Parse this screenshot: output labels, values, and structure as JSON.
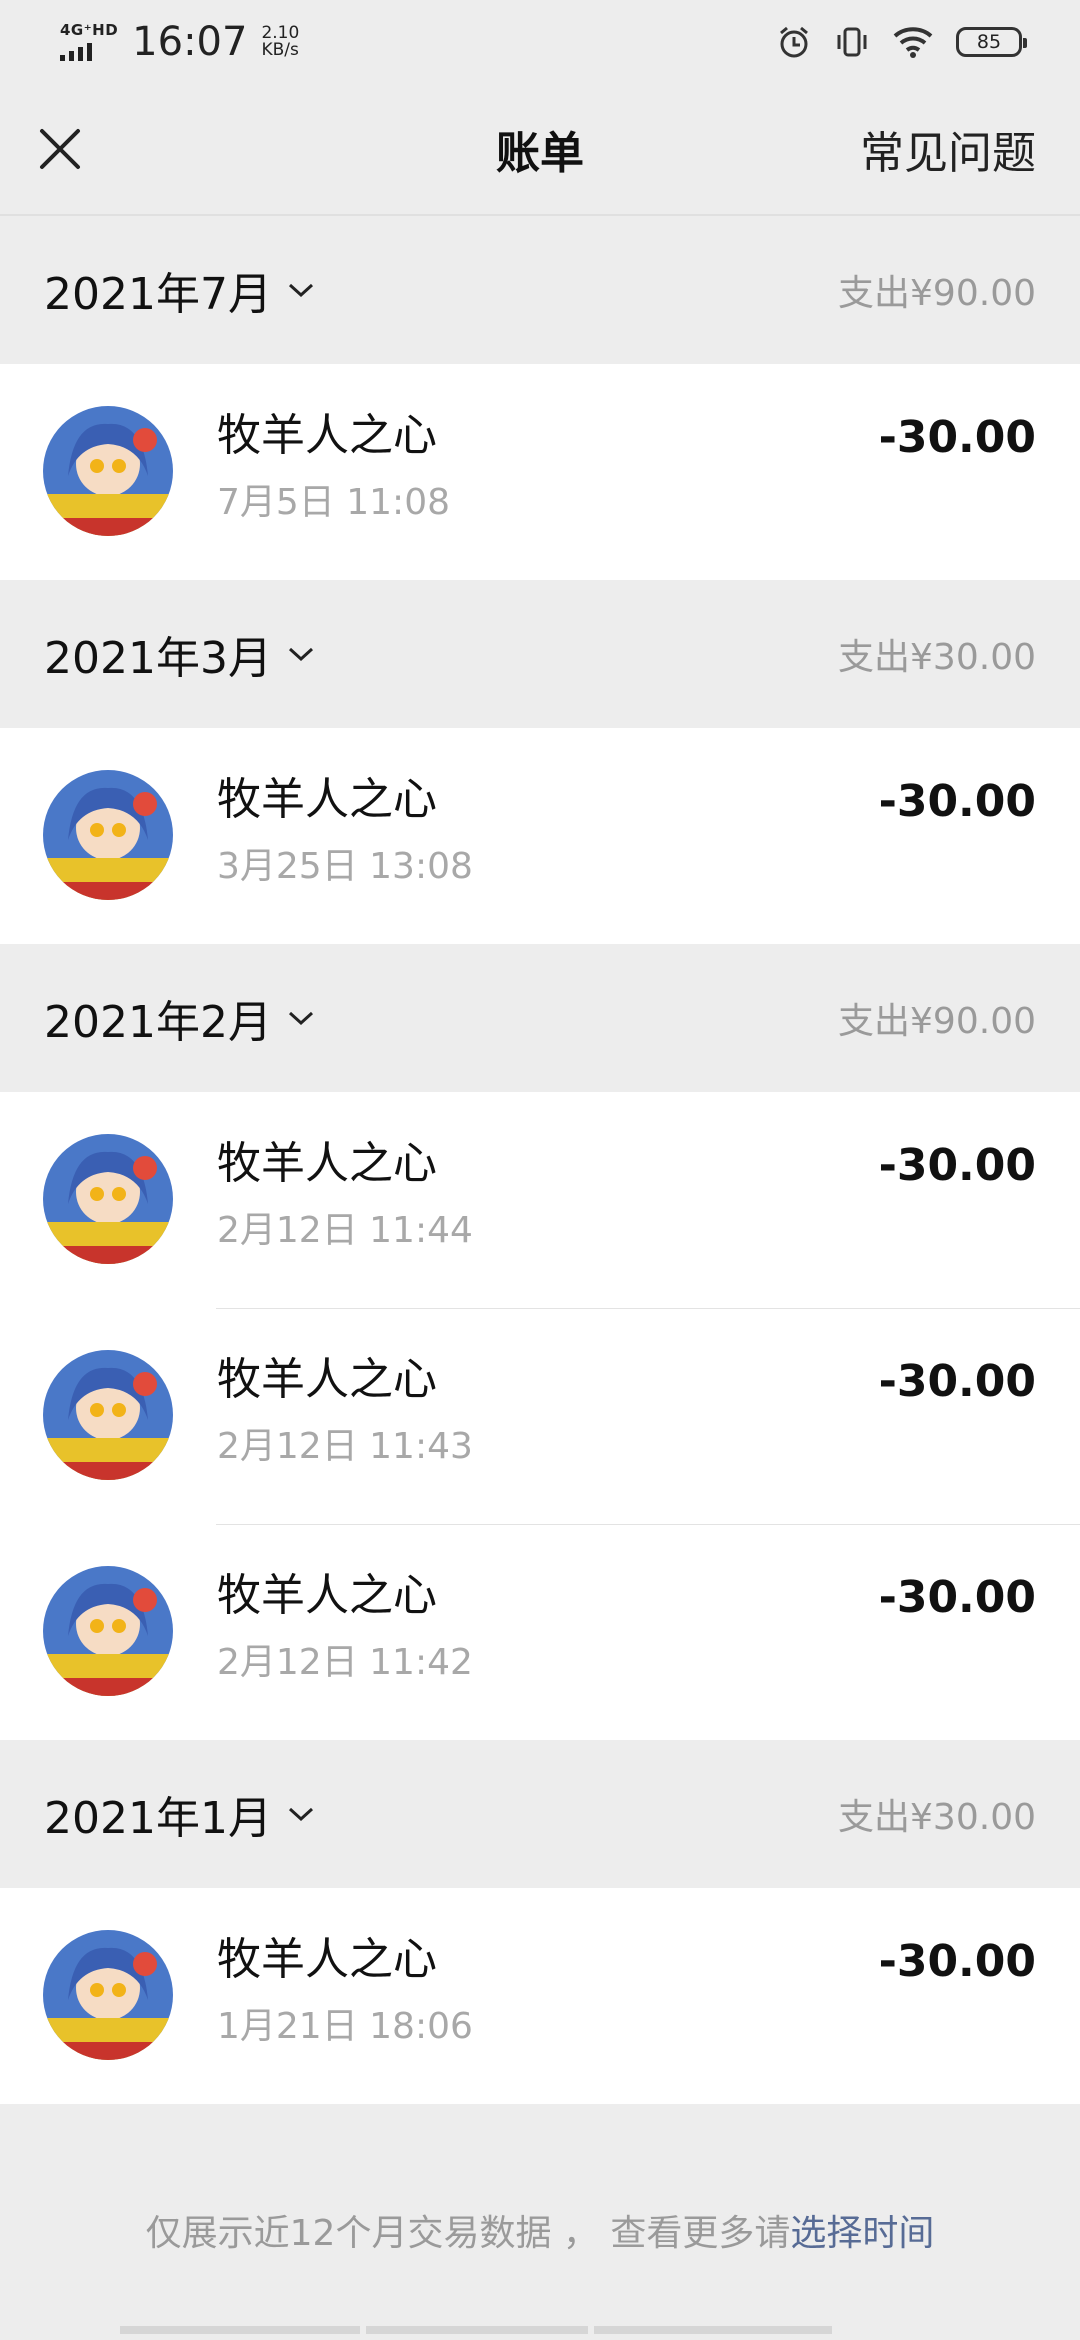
{
  "status_bar": {
    "network": "4G⁺HD",
    "time": "16:07",
    "speed_value": "2.10",
    "speed_unit": "KB/s",
    "battery": "85",
    "icons": [
      "alarm-icon",
      "vibrate-icon",
      "wifi-icon",
      "battery-icon"
    ]
  },
  "nav": {
    "close_icon": "close-icon",
    "title": "账单",
    "faq_label": "常见问题"
  },
  "groups": [
    {
      "month": "2021年7月",
      "total": "支出¥90.00",
      "records": [
        {
          "name": "牧羊人之心",
          "time": "7月5日 11:08",
          "amount": "-30.00"
        }
      ]
    },
    {
      "month": "2021年3月",
      "total": "支出¥30.00",
      "records": [
        {
          "name": "牧羊人之心",
          "time": "3月25日 13:08",
          "amount": "-30.00"
        }
      ]
    },
    {
      "month": "2021年2月",
      "total": "支出¥90.00",
      "records": [
        {
          "name": "牧羊人之心",
          "time": "2月12日 11:44",
          "amount": "-30.00"
        },
        {
          "name": "牧羊人之心",
          "time": "2月12日 11:43",
          "amount": "-30.00"
        },
        {
          "name": "牧羊人之心",
          "time": "2月12日 11:42",
          "amount": "-30.00"
        }
      ]
    },
    {
      "month": "2021年1月",
      "total": "支出¥30.00",
      "records": [
        {
          "name": "牧羊人之心",
          "time": "1月21日 18:06",
          "amount": "-30.00"
        }
      ]
    }
  ],
  "footer": {
    "note": "仅展示近12个月交易数据 ， 查看更多请",
    "link": "选择时间"
  },
  "colors": {
    "background": "#ededed",
    "card": "#ffffff",
    "secondary_text": "#9a9a9a",
    "link": "#576b95"
  }
}
